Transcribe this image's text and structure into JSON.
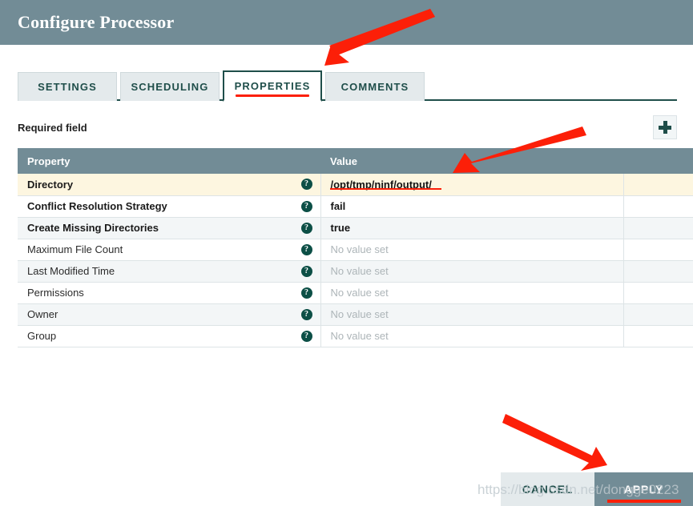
{
  "header": {
    "title": "Configure Processor"
  },
  "tabs": [
    {
      "label": "SETTINGS",
      "active": false
    },
    {
      "label": "SCHEDULING",
      "active": false
    },
    {
      "label": "PROPERTIES",
      "active": true
    },
    {
      "label": "COMMENTS",
      "active": false
    }
  ],
  "toolbar": {
    "required_field_label": "Required field",
    "add_icon": "plus-icon"
  },
  "table": {
    "columns": [
      "Property",
      "Value",
      ""
    ],
    "help_icon": "help-circle-icon",
    "empty_value_text": "No value set",
    "rows": [
      {
        "property": "Directory",
        "value": "/opt/tmp/ninf/output/",
        "required": true,
        "empty": false,
        "highlight": true
      },
      {
        "property": "Conflict Resolution Strategy",
        "value": "fail",
        "required": true,
        "empty": false,
        "highlight": false
      },
      {
        "property": "Create Missing Directories",
        "value": "true",
        "required": true,
        "empty": false,
        "highlight": false
      },
      {
        "property": "Maximum File Count",
        "value": "No value set",
        "required": false,
        "empty": true,
        "highlight": false
      },
      {
        "property": "Last Modified Time",
        "value": "No value set",
        "required": false,
        "empty": true,
        "highlight": false
      },
      {
        "property": "Permissions",
        "value": "No value set",
        "required": false,
        "empty": true,
        "highlight": false
      },
      {
        "property": "Owner",
        "value": "No value set",
        "required": false,
        "empty": true,
        "highlight": false
      },
      {
        "property": "Group",
        "value": "No value set",
        "required": false,
        "empty": true,
        "highlight": false
      }
    ]
  },
  "footer": {
    "cancel_label": "CANCEL",
    "apply_label": "APPLY"
  },
  "watermark": {
    "text": "https://blog.csdn.net/dongge0223"
  },
  "colors": {
    "header_bg": "#728c96",
    "accent_green": "#1f4e4a",
    "annotation_red": "#fc1f08",
    "highlight_row": "#fdf6e0"
  }
}
